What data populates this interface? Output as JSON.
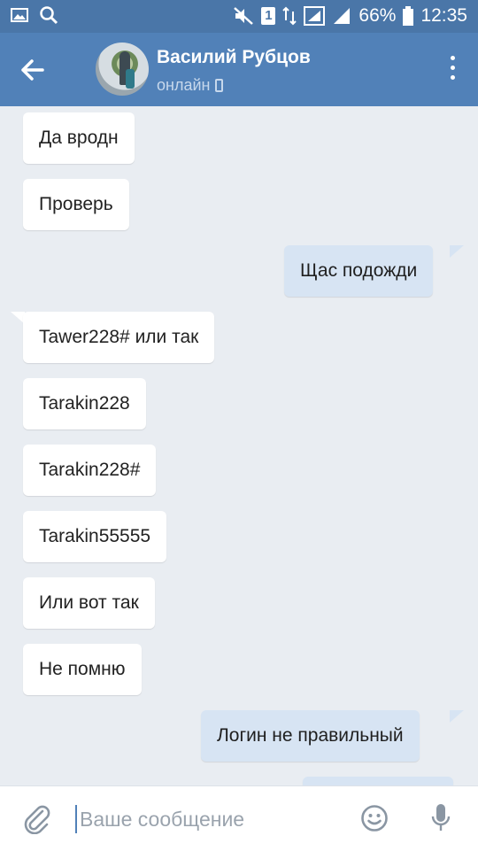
{
  "status_bar": {
    "battery": "66%",
    "time": "12:35",
    "sim_badge": "1"
  },
  "header": {
    "contact_name": "Василий Рубцов",
    "contact_status": "онлайн"
  },
  "messages": [
    {
      "direction": "in",
      "text": "Да вродн"
    },
    {
      "direction": "in",
      "text": "Проверь"
    },
    {
      "direction": "out",
      "text": "Щас подожди"
    },
    {
      "direction": "in",
      "text": "Tawer228# или так"
    },
    {
      "direction": "in",
      "text": "Tarakin228"
    },
    {
      "direction": "in",
      "text": "Tarakin228#"
    },
    {
      "direction": "in",
      "text": "Tarakin55555"
    },
    {
      "direction": "in",
      "text": "Или вот так"
    },
    {
      "direction": "in",
      "text": "Не помню"
    },
    {
      "direction": "out",
      "text": "Логин не правильный"
    },
    {
      "direction": "out",
      "text": ""
    }
  ],
  "composer": {
    "placeholder": "Ваше сообщение",
    "value": ""
  },
  "colors": {
    "header": "#5181b8",
    "status_bar": "#4a76a8",
    "background": "#e9edf2",
    "incoming_bubble": "#ffffff",
    "outgoing_bubble": "#d7e4f3"
  }
}
